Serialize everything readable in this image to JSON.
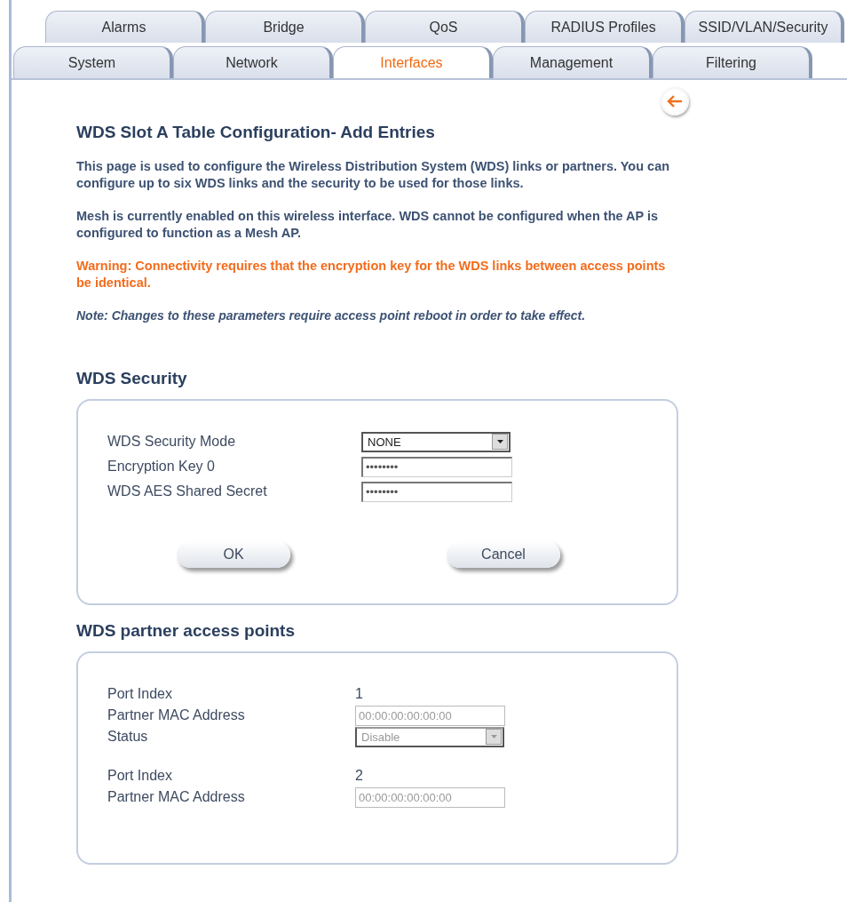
{
  "tabs": {
    "rows": [
      [
        {
          "label": "Alarms",
          "selected": false
        },
        {
          "label": "Bridge",
          "selected": false
        },
        {
          "label": "QoS",
          "selected": false
        },
        {
          "label": "RADIUS Profiles",
          "selected": false
        },
        {
          "label": "SSID/VLAN/Security",
          "selected": false
        }
      ],
      [
        {
          "label": "System",
          "selected": false
        },
        {
          "label": "Network",
          "selected": false
        },
        {
          "label": "Interfaces",
          "selected": true
        },
        {
          "label": "Management",
          "selected": false
        },
        {
          "label": "Filtering",
          "selected": false
        }
      ]
    ]
  },
  "title": "WDS Slot A Table Configuration- Add Entries",
  "paragraphs": [
    {
      "kind": "info",
      "text": "This page is used to configure the Wireless Distribution System (WDS) links or partners. You can configure up to six WDS links and the security to be used for those links."
    },
    {
      "kind": "info",
      "text": "Mesh is currently enabled on this wireless interface. WDS cannot be configured when the AP is configured to function as a Mesh AP."
    },
    {
      "kind": "warning",
      "text": "Warning: Connectivity requires that the encryption key for the WDS links between access points be identical."
    },
    {
      "kind": "note",
      "text": "Note: Changes to these parameters require access point reboot in order to take effect."
    }
  ],
  "security": {
    "heading": "WDS Security",
    "fields": [
      {
        "label": "WDS Security Mode",
        "kind": "select",
        "value": "NONE",
        "disabled": false
      },
      {
        "label": "Encryption Key 0",
        "kind": "input",
        "value": "••••••••",
        "disabled": false
      },
      {
        "label": "WDS AES Shared Secret",
        "kind": "input",
        "value": "••••••••",
        "disabled": false
      }
    ],
    "buttons": [
      "OK",
      "Cancel"
    ]
  },
  "partners": {
    "heading": "WDS partner access points",
    "groups": [
      {
        "fields": [
          {
            "label": "Port Index",
            "kind": "text",
            "value": "1"
          },
          {
            "label": "Partner MAC Address",
            "kind": "input",
            "value": "00:00:00:00:00:00",
            "disabled": true
          },
          {
            "label": "Status",
            "kind": "select",
            "value": "Disable",
            "disabled": true
          }
        ]
      },
      {
        "fields": [
          {
            "label": "Port Index",
            "kind": "text",
            "value": "2"
          },
          {
            "label": "Partner MAC Address",
            "kind": "input",
            "value": "00:00:00:00:00:00",
            "disabled": true
          }
        ]
      }
    ]
  }
}
